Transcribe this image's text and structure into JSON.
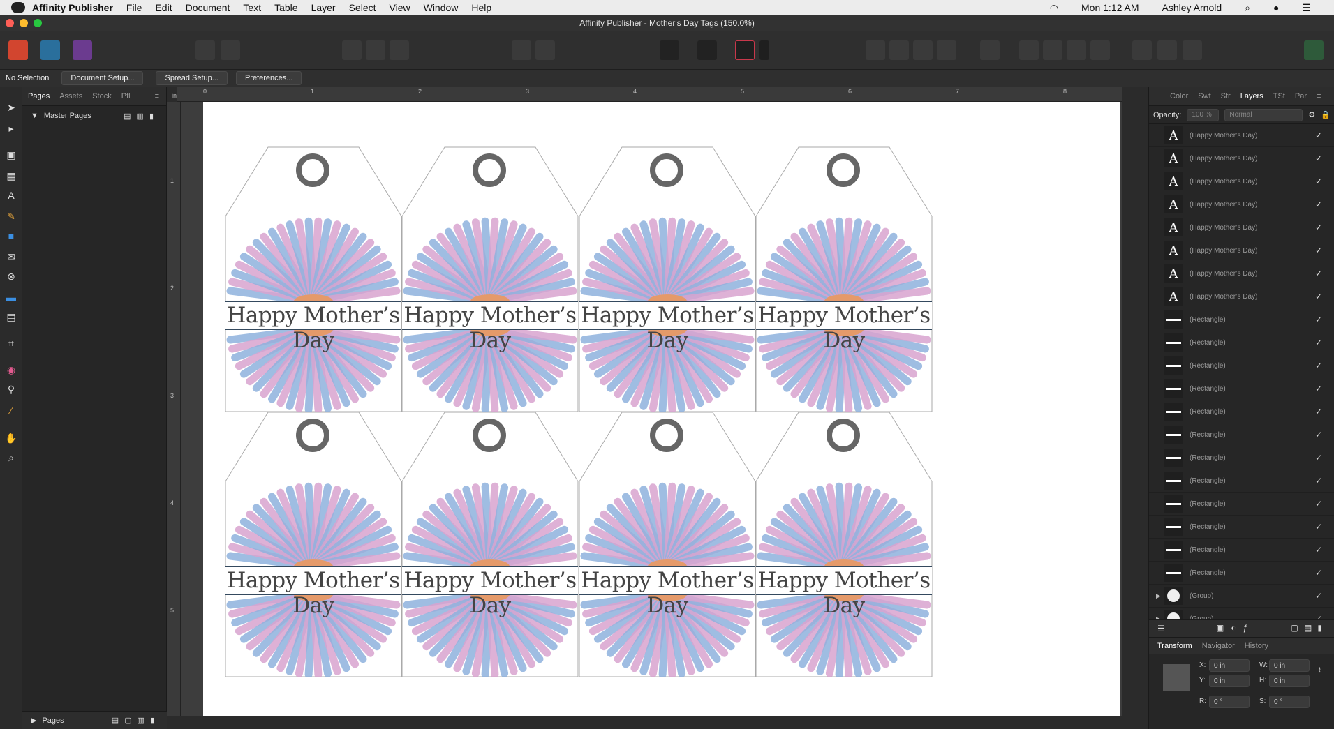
{
  "menubar": {
    "app": "Affinity Publisher",
    "items": [
      "File",
      "Edit",
      "Document",
      "Text",
      "Table",
      "Layer",
      "Select",
      "View",
      "Window",
      "Help"
    ],
    "clock": "Mon 1:12 AM",
    "user": "Ashley Arnold"
  },
  "window": {
    "title": "Affinity Publisher - Mother's Day Tags (150.0%)"
  },
  "context": {
    "selection": "No Selection",
    "document_setup": "Document Setup...",
    "spread_setup": "Spread Setup...",
    "preferences": "Preferences..."
  },
  "left_panel": {
    "tabs": [
      "Pages",
      "Assets",
      "Stock",
      "Pfl"
    ],
    "master_pages": "Master Pages",
    "pages": "Pages"
  },
  "ruler": {
    "unit": "in",
    "h": [
      "0",
      "1",
      "2",
      "3",
      "4",
      "5",
      "6",
      "7",
      "8"
    ],
    "v": [
      "1",
      "2",
      "3",
      "4",
      "5"
    ]
  },
  "tag_text": "Happy Mother’s Day",
  "right_panel": {
    "tabs": [
      "Color",
      "Swt",
      "Str",
      "Layers",
      "TSt",
      "Par"
    ],
    "opacity_label": "Opacity:",
    "opacity": "100 %",
    "blend": "Normal",
    "layers": [
      "(Happy Mother’s Day)",
      "(Happy Mother’s Day)",
      "(Happy Mother’s Day)",
      "(Happy Mother’s Day)",
      "(Happy Mother’s Day)",
      "(Happy Mother’s Day)",
      "(Happy Mother’s Day)",
      "(Happy Mother’s Day)",
      "(Rectangle)",
      "(Rectangle)",
      "(Rectangle)",
      "(Rectangle)",
      "(Rectangle)",
      "(Rectangle)",
      "(Rectangle)",
      "(Rectangle)",
      "(Rectangle)",
      "(Rectangle)",
      "(Rectangle)",
      "(Rectangle)",
      "(Group)",
      "(Group)"
    ],
    "transform_tabs": [
      "Transform",
      "Navigator",
      "History"
    ],
    "x_label": "X:",
    "y_label": "Y:",
    "w_label": "W:",
    "h_label": "H:",
    "r_label": "R:",
    "s_label": "S:",
    "x": "0 in",
    "y": "0 in",
    "w": "0 in",
    "h": "0 in",
    "r": "0 °",
    "s": "0 °"
  },
  "colors": {
    "accent": "#c8384b",
    "petal_pink": "#d9a4d0",
    "petal_blue": "#8fb2de",
    "ring": "#666666"
  }
}
